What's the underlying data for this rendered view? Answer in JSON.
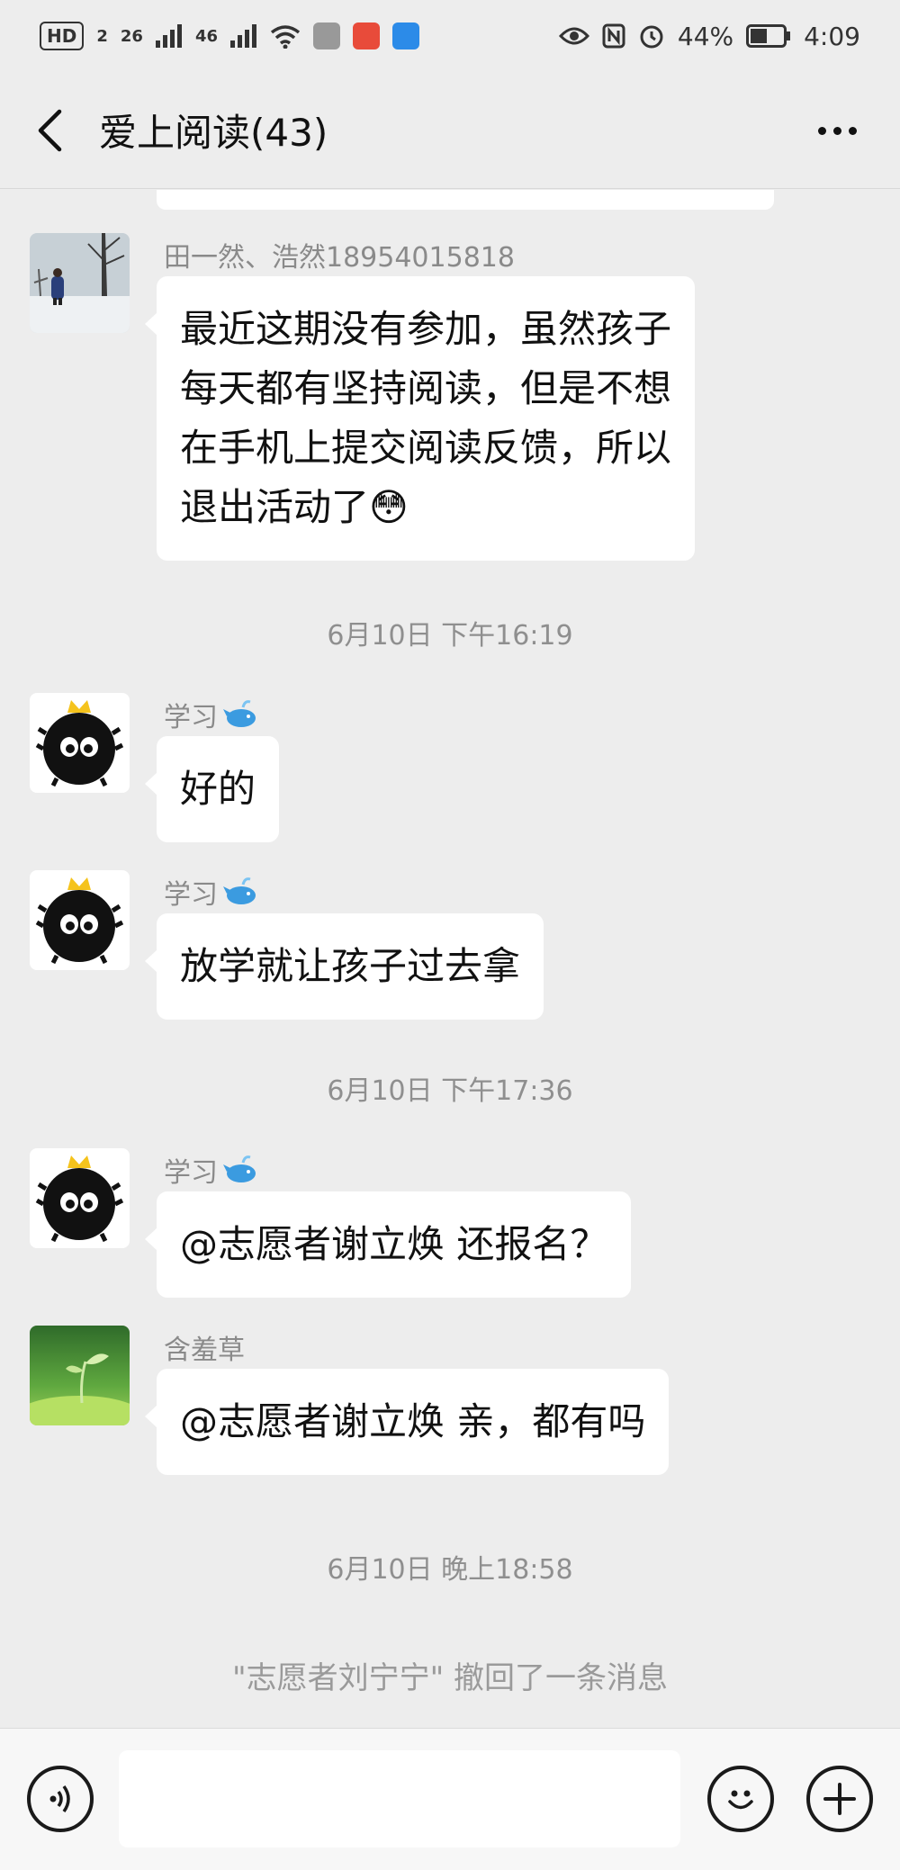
{
  "status_bar": {
    "left_chip": "HD",
    "left_chip_sub": "2",
    "signal_1_label": "26",
    "signal_2_label": "46",
    "battery_percent": "44%",
    "time": "4:09"
  },
  "header": {
    "title": "爱上阅读(43)"
  },
  "messages": [
    {
      "sender": "田一然、浩然18954015818",
      "lines": [
        "最近这期没有参加，虽然孩子",
        "每天都有坚持阅读，但是不想",
        "在手机上提交阅读反馈，所以",
        "退出活动了"
      ],
      "emoji": "😳"
    },
    {
      "sender": "学习",
      "lines": [
        "好的"
      ]
    },
    {
      "sender": "学习",
      "lines": [
        "放学就让孩子过去拿"
      ]
    },
    {
      "sender": "学习",
      "lines": [
        "@志愿者谢立焕  还报名？"
      ]
    },
    {
      "sender": "含羞草",
      "lines": [
        "@志愿者谢立焕  亲，都有吗"
      ]
    }
  ],
  "timestamps": [
    "6月10日 下午16:19",
    "6月10日 下午17:36",
    "6月10日 晚上18:58"
  ],
  "system_notice": "\"志愿者刘宁宁\" 撤回了一条消息",
  "colors": {
    "background": "#ededed",
    "bubble": "#ffffff",
    "timestamp": "#8f8f8f"
  }
}
